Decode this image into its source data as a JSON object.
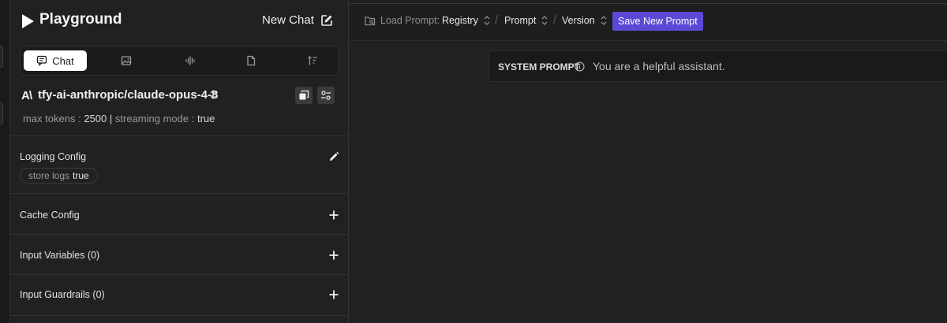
{
  "app": {
    "title": "Playground",
    "new_chat_label": "New Chat"
  },
  "tabs": [
    {
      "label": "Chat",
      "icon": "chat-icon",
      "active": true
    },
    {
      "label": "",
      "icon": "image-icon"
    },
    {
      "label": "",
      "icon": "audio-wave-icon"
    },
    {
      "label": "",
      "icon": "document-icon"
    },
    {
      "label": "",
      "icon": "sort-icon"
    }
  ],
  "model": {
    "logo": "A\\",
    "name": "tfy-ai-anthropic/claude-opus-4-8",
    "max_tokens_label": "max tokens :",
    "max_tokens_value": "2500",
    "separator": "|",
    "streaming_label": "streaming mode :",
    "streaming_value": "true"
  },
  "sections": {
    "logging": {
      "title": "Logging Config",
      "chip_label": "store logs",
      "chip_value": "true"
    },
    "cache": {
      "title": "Cache Config"
    },
    "input_variables": {
      "title": "Input Variables (0)"
    },
    "input_guardrails": {
      "title": "Input Guardrails (0)"
    }
  },
  "topbar": {
    "load_prompt_label": "Load Prompt:",
    "registry": "Registry",
    "prompt": "Prompt",
    "version": "Version",
    "save_button": "Save New Prompt"
  },
  "system_prompt": {
    "label": "SYSTEM PROMPT",
    "text": "You are a helpful assistant."
  },
  "colors": {
    "accent": "#5b49d6",
    "background": "#212121",
    "panel": "#1a1a1a"
  }
}
